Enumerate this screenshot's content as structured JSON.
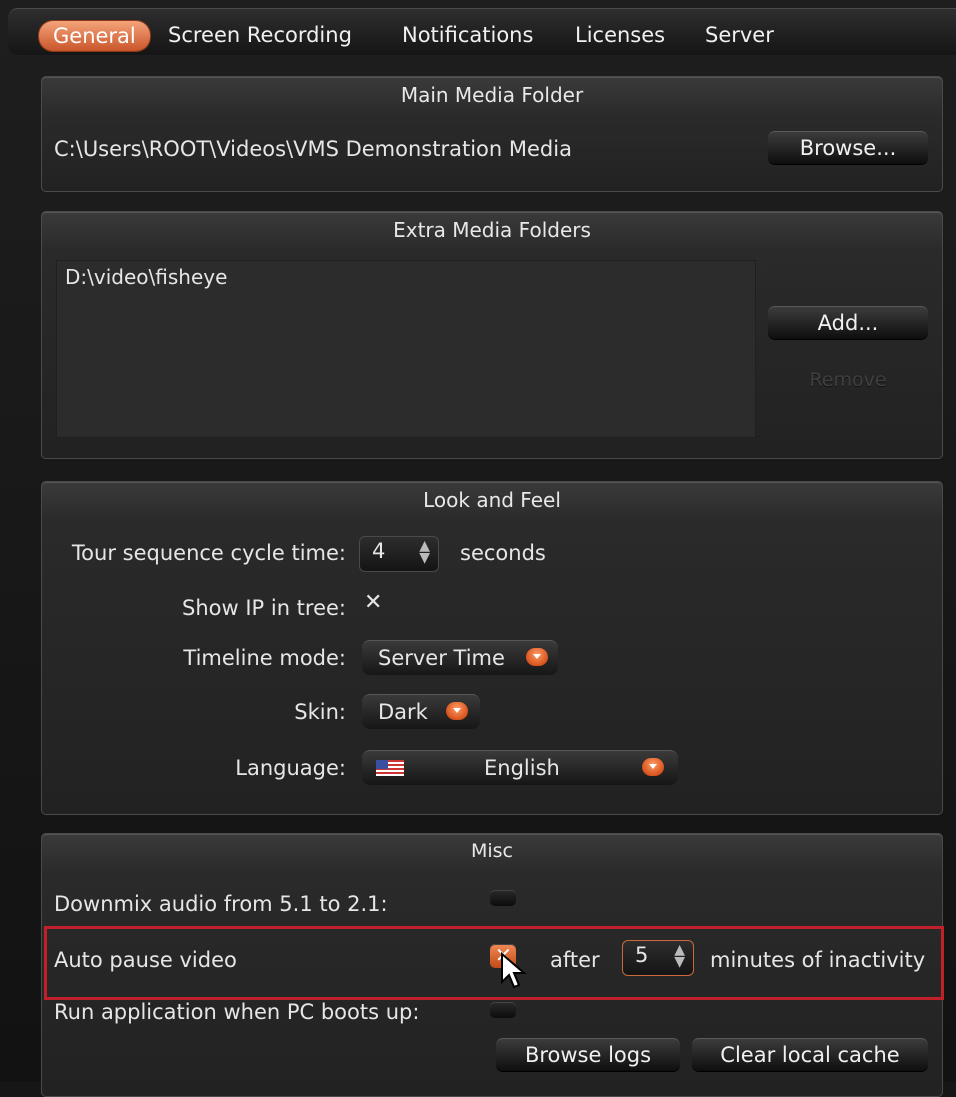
{
  "tabs": [
    "General",
    "Screen Recording",
    "Notifications",
    "Licenses",
    "Server"
  ],
  "active_tab": "General",
  "main_media": {
    "title": "Main Media Folder",
    "path": "C:\\Users\\ROOT\\Videos\\VMS Demonstration Media",
    "browse_label": "Browse..."
  },
  "extra_media": {
    "title": "Extra Media Folders",
    "folders": [
      "D:\\video\\fisheye"
    ],
    "add_label": "Add...",
    "remove_label": "Remove"
  },
  "look_feel": {
    "title": "Look and Feel",
    "tour_label": "Tour sequence cycle time:",
    "tour_value": "4",
    "tour_unit": "seconds",
    "show_ip_label": "Show IP in tree:",
    "show_ip_checked": true,
    "timeline_label": "Timeline mode:",
    "timeline_value": "Server Time",
    "skin_label": "Skin:",
    "skin_value": "Dark",
    "language_label": "Language:",
    "language_value": "English"
  },
  "misc": {
    "title": "Misc",
    "downmix_label": "Downmix audio from 5.1 to 2.1:",
    "downmix_checked": false,
    "autopause_label": "Auto pause video",
    "autopause_checked": true,
    "after_label": "after",
    "minutes_value": "5",
    "minutes_label": "minutes of inactivity",
    "boot_label": "Run application when PC boots up:",
    "boot_checked": false,
    "browse_logs_label": "Browse logs",
    "clear_cache_label": "Clear local cache"
  },
  "colors": {
    "accent": "#e0622e",
    "highlight_border": "#c0202a"
  }
}
